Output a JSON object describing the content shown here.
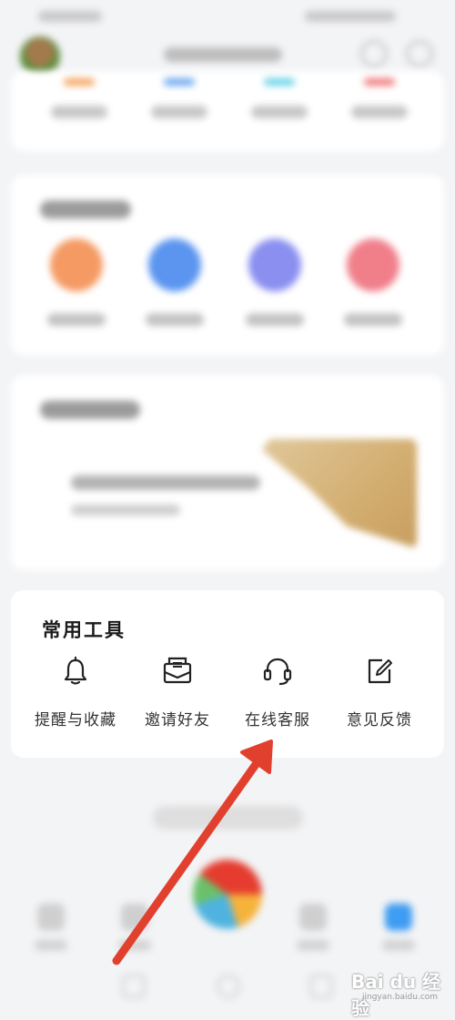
{
  "tools_section": {
    "title": "常用工具",
    "items": [
      {
        "label": "提醒与收藏",
        "icon": "bell-icon"
      },
      {
        "label": "邀请好友",
        "icon": "invite-envelope-icon"
      },
      {
        "label": "在线客服",
        "icon": "headset-icon"
      },
      {
        "label": "意见反馈",
        "icon": "feedback-edit-icon"
      }
    ]
  },
  "colors": {
    "stat_bars": [
      "#f4a460",
      "#6aa8f0",
      "#69d3e8",
      "#f07a7a"
    ],
    "service_circles": [
      "#f59a63",
      "#5b95ef",
      "#8a8ff0",
      "#f07f8a"
    ],
    "arrow": "#e2402f"
  },
  "watermark": {
    "text": "Bai du 经验",
    "sub": "jingyan.baidu.com"
  }
}
